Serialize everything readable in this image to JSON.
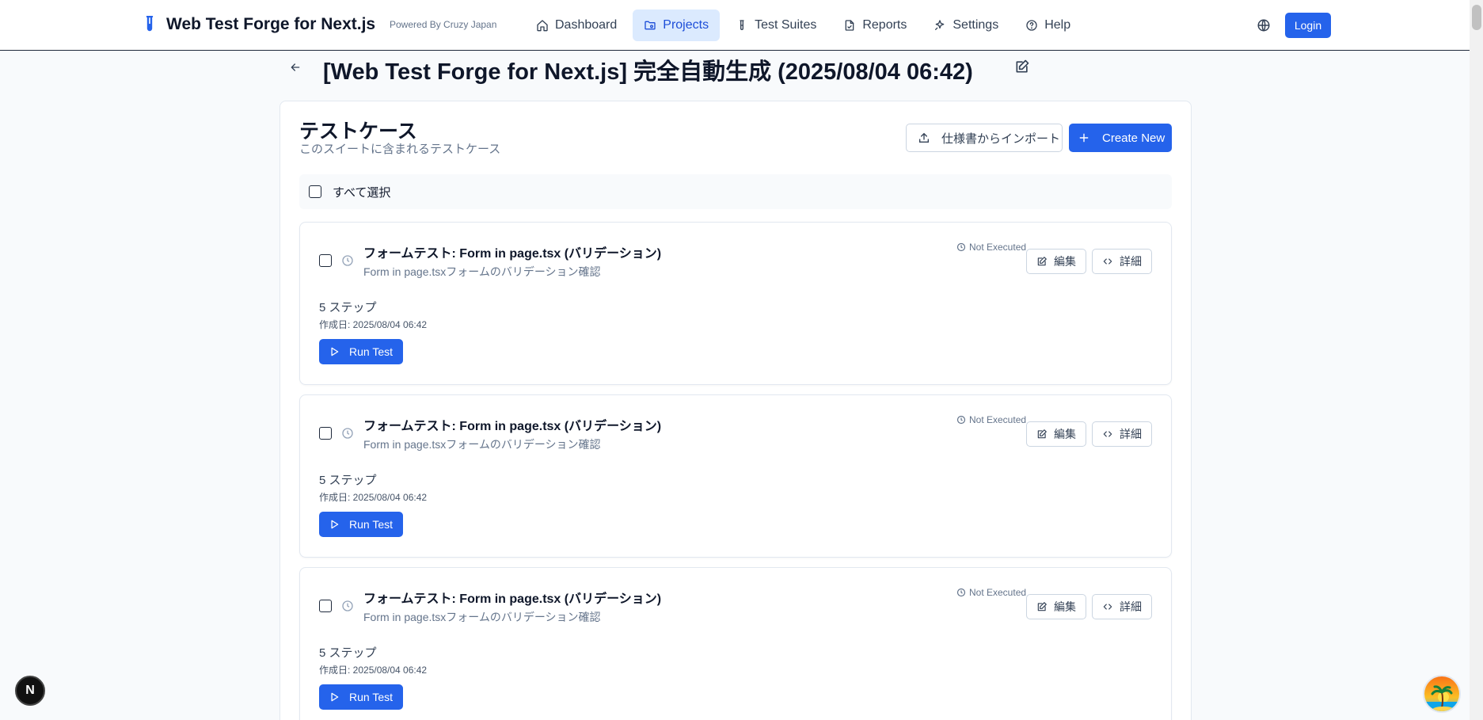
{
  "header": {
    "brand_title": "Web Test Forge for Next.js",
    "powered_by": "Powered By Cruzy Japan",
    "nav": [
      {
        "label": "Dashboard",
        "icon": "home-icon",
        "active": false
      },
      {
        "label": "Projects",
        "icon": "folder-icon",
        "active": true
      },
      {
        "label": "Test Suites",
        "icon": "test-tube-icon",
        "active": false
      },
      {
        "label": "Reports",
        "icon": "report-icon",
        "active": false
      },
      {
        "label": "Settings",
        "icon": "sparkle-icon",
        "active": false
      },
      {
        "label": "Help",
        "icon": "help-icon",
        "active": false
      }
    ],
    "login_label": "Login"
  },
  "page": {
    "title": "[Web Test Forge for Next.js] 完全自動生成 (2025/08/04 06:42)"
  },
  "section": {
    "title": "テストケース",
    "subtitle": "このスイートに含まれるテストケース",
    "import_label": "仕様書からインポート",
    "create_label": "Create New",
    "select_all_label": "すべて選択"
  },
  "test_cases": [
    {
      "title": "フォームテスト: Form in page.tsx (バリデーション)",
      "description": "Form in page.tsxフォームのバリデーション確認",
      "status": "Not Executed",
      "edit_label": "編集",
      "detail_label": "詳細",
      "steps": "5 ステップ",
      "created": "作成日: 2025/08/04 06:42",
      "run_label": "Run Test"
    },
    {
      "title": "フォームテスト: Form in page.tsx (バリデーション)",
      "description": "Form in page.tsxフォームのバリデーション確認",
      "status": "Not Executed",
      "edit_label": "編集",
      "detail_label": "詳細",
      "steps": "5 ステップ",
      "created": "作成日: 2025/08/04 06:42",
      "run_label": "Run Test"
    },
    {
      "title": "フォームテスト: Form in page.tsx (バリデーション)",
      "description": "Form in page.tsxフォームのバリデーション確認",
      "status": "Not Executed",
      "edit_label": "編集",
      "detail_label": "詳細",
      "steps": "5 ステップ",
      "created": "作成日: 2025/08/04 06:42",
      "run_label": "Run Test"
    }
  ],
  "floating": {
    "next_badge": "N"
  },
  "colors": {
    "primary": "#2563eb",
    "nav_active_bg": "#dbeafe",
    "muted_text": "#64748b"
  }
}
